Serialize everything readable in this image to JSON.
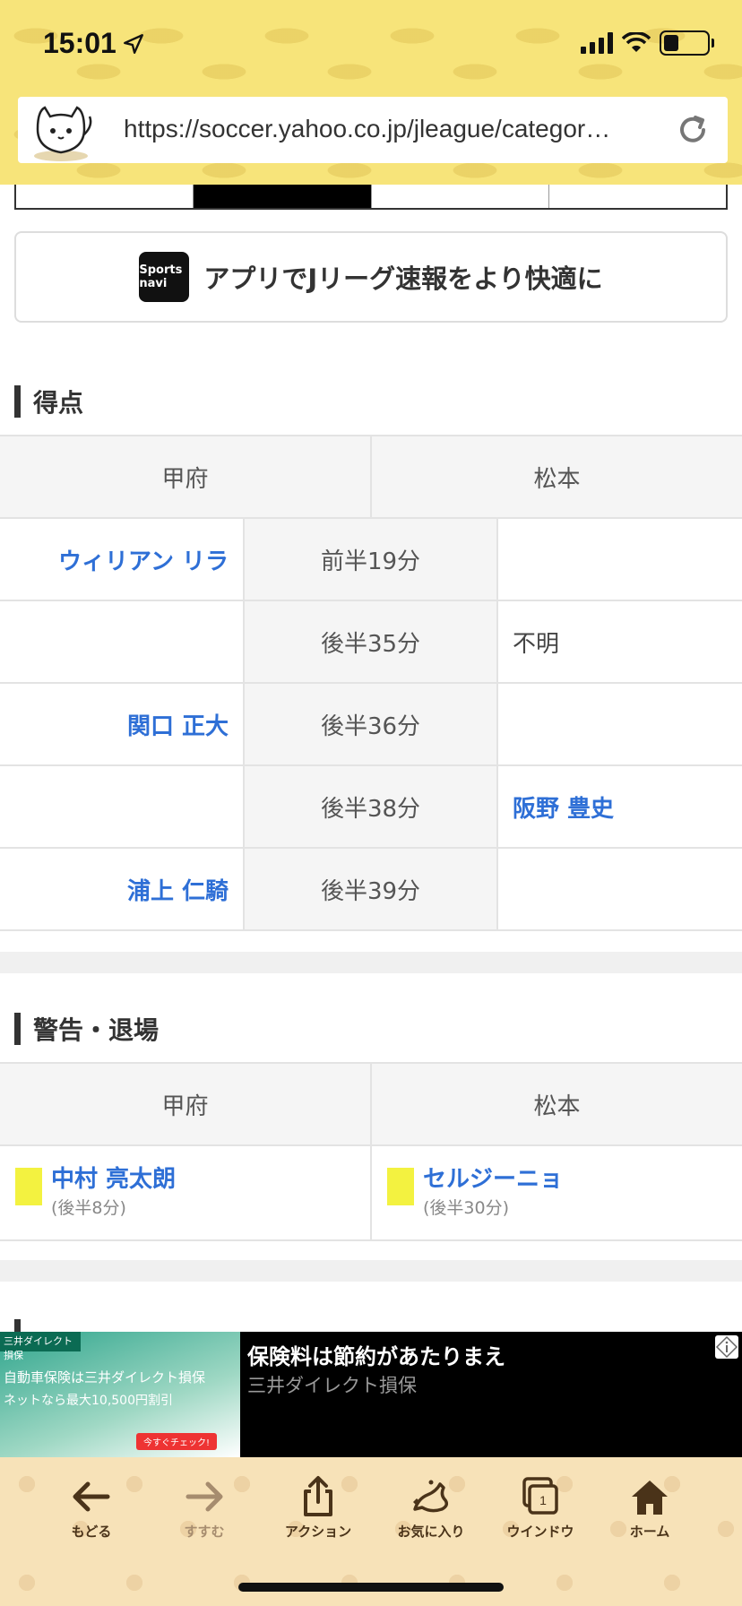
{
  "status": {
    "time": "15:01"
  },
  "browser": {
    "url": "https://soccer.yahoo.co.jp/jleague/categor…"
  },
  "app_banner": {
    "logo": "Sports navi",
    "text": "アプリでJリーグ速報をより快適に"
  },
  "goals": {
    "title": "得点",
    "home_team": "甲府",
    "away_team": "松本",
    "rows": [
      {
        "home": "ウィリアン リラ",
        "time": "前半19分",
        "away": ""
      },
      {
        "home": "",
        "time": "後半35分",
        "away": "不明"
      },
      {
        "home": "関口 正大",
        "time": "後半36分",
        "away": ""
      },
      {
        "home": "",
        "time": "後半38分",
        "away": "阪野 豊史"
      },
      {
        "home": "浦上 仁騎",
        "time": "後半39分",
        "away": ""
      }
    ]
  },
  "cards": {
    "title": "警告・退場",
    "home_team": "甲府",
    "away_team": "松本",
    "home_player": "中村 亮太朗",
    "home_time": "(後半8分)",
    "away_player": "セルジーニョ",
    "away_time": "(後半30分)",
    "card_color": "#f3f240"
  },
  "ad": {
    "brand": "三井ダイレクト損保",
    "image_line1": "自動車保険は三井ダイレクト損保",
    "image_line2": "ネットなら最大10,500円割引",
    "cta": "今すぐチェック!",
    "title": "保険料は節約があたりまえ",
    "advertiser": "三井ダイレクト損保"
  },
  "toolbar": {
    "back": "もどる",
    "forward": "すすむ",
    "action": "アクション",
    "favorites": "お気に入り",
    "window": "ウインドウ",
    "window_count": "1",
    "home": "ホーム"
  }
}
